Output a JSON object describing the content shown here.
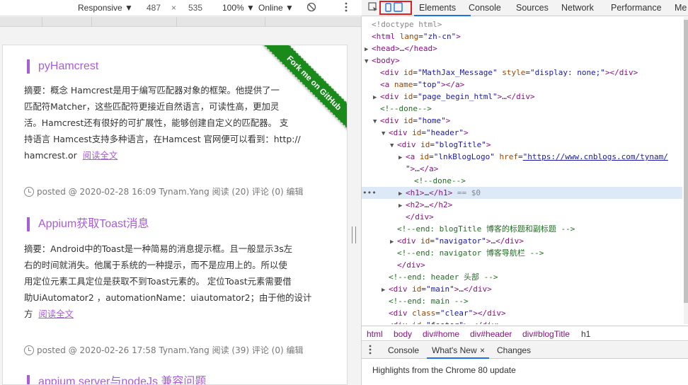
{
  "device_toolbar": {
    "preset": "Responsive ▼",
    "width": "487",
    "times": "×",
    "height": "535",
    "zoom": "100% ▼",
    "throttle": "Online ▼",
    "rotate_icon": "rotate-icon",
    "more_icon": "more-vert-icon"
  },
  "page": {
    "ribbon": "Fork me on GitHub",
    "posts": [
      {
        "title": "pyHamcrest",
        "lines": [
          "摘要：概念 Hamcrest是用于编写匹配器对象的框架。他提供了一",
          "匹配符Matcher，这些匹配符更接近自然语言，可读性高，更加灵",
          "活。Hamcrest还有很好的可扩展性，能够创建自定义的匹配器。 支",
          "持语言 Hamcest支持多种语言，在Hamcest 官网便可以看到：http://",
          "hamcrest.or"
        ],
        "more": "阅读全文",
        "meta": "posted @ 2020-02-28 16:09 Tynam.Yang 阅读 (20) 评论 (0) 编辑"
      },
      {
        "title": "Appium获取Toast消息",
        "lines": [
          "摘要：Android中的Toast是一种简易的消息提示框。且一般显示3s左",
          "右的时间就消失。他属于系统的一种提示，而不是应用上的。所以使",
          "用定位元素工具定位是获取不到Toast元素的。 定位Toast元素需要借",
          "助UiAutomator2 ，automationName：uiautomator2；由于他的设计",
          "方"
        ],
        "more": "阅读全文",
        "meta": "posted @ 2020-02-26 17:58 Tynam.Yang 阅读 (39) 评论 (0) 编辑"
      },
      {
        "title": "appium server与nodeJs 兼容问题"
      }
    ]
  },
  "devtools": {
    "tabs": [
      "Elements",
      "Console",
      "Sources",
      "Network",
      "Performance",
      "Me"
    ],
    "tree": [
      {
        "i": 0,
        "html": "<span class='gr'>&lt;!doctype html&gt;</span>"
      },
      {
        "i": 0,
        "html": "<span class='tg'>&lt;html</span> <span class='at'>lang</span>=<span class='av'>\"zh-cn\"</span><span class='tg'>&gt;</span>"
      },
      {
        "i": 0,
        "a": "▶",
        "html": "<span class='tg'>&lt;head&gt;</span>…<span class='tg'>&lt;/head&gt;</span>"
      },
      {
        "i": 0,
        "a": "▼",
        "html": "<span class='tg'>&lt;body&gt;</span>"
      },
      {
        "i": 1,
        "html": "<span class='tg'>&lt;div</span> <span class='at'>id</span>=<span class='av'>\"MathJax_Message\"</span> <span class='at'>style</span>=<span class='av'>\"display: none;\"</span><span class='tg'>&gt;&lt;/div&gt;</span>"
      },
      {
        "i": 1,
        "html": "<span class='tg'>&lt;a</span> <span class='at'>name</span>=<span class='av'>\"top\"</span><span class='tg'>&gt;&lt;/a&gt;</span>"
      },
      {
        "i": 1,
        "a": "▶",
        "html": "<span class='tg'>&lt;div</span> <span class='at'>id</span>=<span class='av'>\"page_begin_html\"</span><span class='tg'>&gt;</span>…<span class='tg'>&lt;/div&gt;</span>"
      },
      {
        "i": 1,
        "html": "<span class='cm'>&lt;!--done--&gt;</span>"
      },
      {
        "i": 1,
        "a": "▼",
        "html": "<span class='tg'>&lt;div</span> <span class='at'>id</span>=<span class='av'>\"home\"</span><span class='tg'>&gt;</span>"
      },
      {
        "i": 2,
        "a": "▼",
        "html": "<span class='tg'>&lt;div</span> <span class='at'>id</span>=<span class='av'>\"header\"</span><span class='tg'>&gt;</span>"
      },
      {
        "i": 3,
        "a": "▼",
        "html": "<span class='tg'>&lt;div</span> <span class='at'>id</span>=<span class='av'>\"blogTitle\"</span><span class='tg'>&gt;</span>"
      },
      {
        "i": 4,
        "a": "▶",
        "html": "<span class='tg'>&lt;a</span> <span class='at'>id</span>=<span class='av'>\"lnkBlogLogo\"</span> <span class='at'>href</span>=<span class='av link'>\"https://www.cnblogs.com/tynam/</span>"
      },
      {
        "i": 4,
        "html": "<span class='av'>\"</span><span class='tg'>&gt;</span>…<span class='tg'>&lt;/a&gt;</span>"
      },
      {
        "i": 5,
        "html": "<span class='cm'>&lt;!--done--&gt;</span>"
      },
      {
        "i": 4,
        "a": "▶",
        "sel": true,
        "html": "<span class='tg'>&lt;h1&gt;</span>…<span class='tg'>&lt;/h1&gt;</span> <span class='gr'>== $0</span>"
      },
      {
        "i": 4,
        "a": "▶",
        "html": "<span class='tg'>&lt;h2&gt;</span>…<span class='tg'>&lt;/h2&gt;</span>"
      },
      {
        "i": 4,
        "html": "<span class='tg'>&lt;/div&gt;</span>"
      },
      {
        "i": 3,
        "html": "<span class='cm'>&lt;!--end: blogTitle 博客的标题和副标题 --&gt;</span>"
      },
      {
        "i": 3,
        "a": "▶",
        "html": "<span class='tg'>&lt;div</span> <span class='at'>id</span>=<span class='av'>\"navigator\"</span><span class='tg'>&gt;</span>…<span class='tg'>&lt;/div&gt;</span>"
      },
      {
        "i": 3,
        "html": "<span class='cm'>&lt;!--end: navigator 博客导航栏 --&gt;</span>"
      },
      {
        "i": 3,
        "html": "<span class='tg'>&lt;/div&gt;</span>"
      },
      {
        "i": 2,
        "html": "<span class='cm'>&lt;!--end: header 头部 --&gt;</span>"
      },
      {
        "i": 2,
        "a": "▶",
        "html": "<span class='tg'>&lt;div</span> <span class='at'>id</span>=<span class='av'>\"main\"</span><span class='tg'>&gt;</span>…<span class='tg'>&lt;/div&gt;</span>"
      },
      {
        "i": 2,
        "html": "<span class='cm'>&lt;!--end: main --&gt;</span>"
      },
      {
        "i": 2,
        "html": "<span class='tg'>&lt;div</span> <span class='at'>class</span>=<span class='av'>\"clear\"</span><span class='tg'>&gt;&lt;/div&gt;</span>"
      },
      {
        "i": 2,
        "a": "▶",
        "html": "<span class='tg'>&lt;div</span> <span class='at'>id</span>=<span class='av'>\"footer\"</span><span class='tg'>&gt;</span>…<span class='tg'>&lt;/div&gt;</span>"
      }
    ],
    "breadcrumbs": [
      "html",
      "body",
      "div#home",
      "div#header",
      "div#blogTitle",
      "h1"
    ],
    "drawer_tabs": [
      "Console",
      "What's New",
      "Changes"
    ],
    "drawer_close": "×",
    "drawer_body": "Highlights from the Chrome 80 update"
  }
}
